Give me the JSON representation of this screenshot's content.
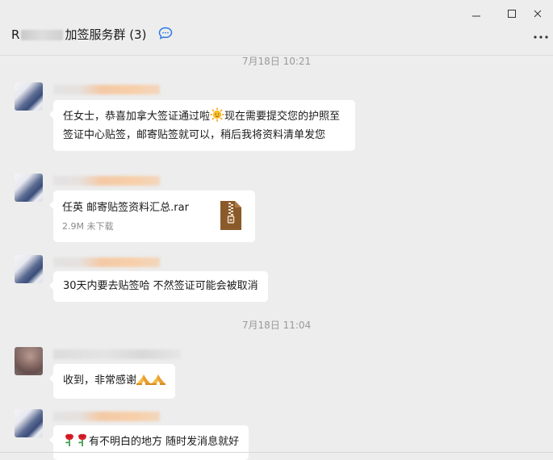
{
  "window": {
    "title_prefix": "R",
    "title_suffix": "加签服务群 (3)",
    "icons": [
      "chat-bubble-icon",
      "minimize-icon",
      "maximize-icon",
      "close-icon",
      "more-icon"
    ]
  },
  "timestamps": [
    "7月18日 10:21",
    "7月18日 11:04"
  ],
  "messages": [
    {
      "type": "text",
      "text_part1": "任女士，恭喜加拿大签证通过啦",
      "emoji": "sun-with-face",
      "text_part2": "现在需要提交您的护照至签证中心贴签，邮寄贴签就可以，稍后我将资料清单发您"
    },
    {
      "type": "file",
      "file_name": "任英 邮寄贴签资料汇总.rar",
      "file_meta": "2.9M 未下载",
      "file_icon": "zip-archive-icon"
    },
    {
      "type": "text",
      "text": "30天内要去贴签哈 不然签证可能会被取消"
    },
    {
      "type": "text",
      "text": "收到，非常感谢",
      "emojis": [
        "folded-hands",
        "folded-hands"
      ]
    },
    {
      "type": "text",
      "emojis": [
        "rose",
        "rose"
      ],
      "text": "有不明白的地方 随时发消息就好"
    }
  ],
  "colors": {
    "background": "#ededed",
    "bubble": "#ffffff",
    "timestamp": "#9a9a9a",
    "file_icon": "#8b5a2b"
  }
}
